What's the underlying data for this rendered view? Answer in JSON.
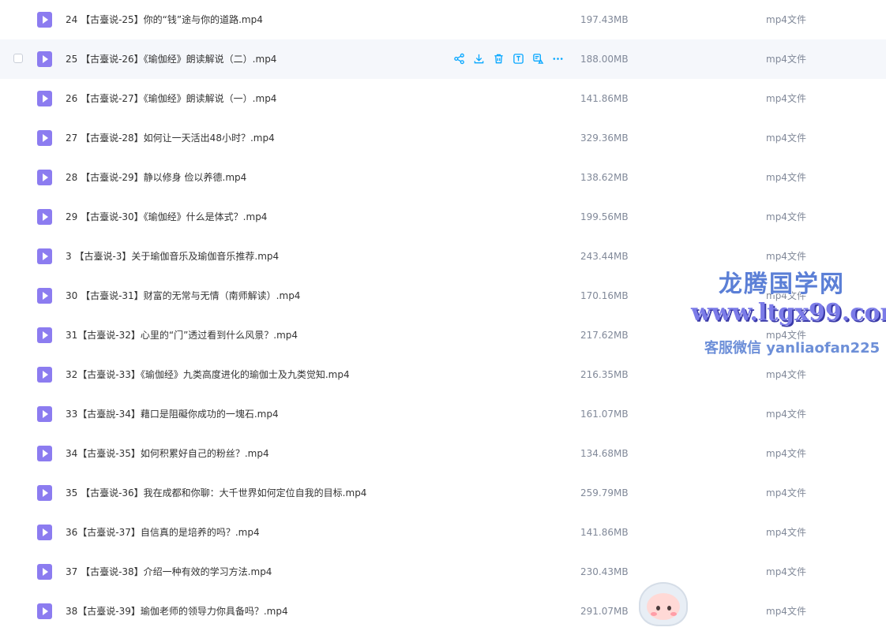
{
  "files": [
    {
      "name": "24 【古臺说-25】你的“钱”途与你的道路.mp4",
      "size": "197.43MB",
      "type": "mp4文件"
    },
    {
      "name": "25 【古臺说-26】《瑜伽经》朗读解说（二）.mp4",
      "size": "188.00MB",
      "type": "mp4文件",
      "hover": true
    },
    {
      "name": "26 【古臺说-27】《瑜伽经》朗读解说（一）.mp4",
      "size": "141.86MB",
      "type": "mp4文件"
    },
    {
      "name": "27 【古臺说-28】如何让一天活出48小时？.mp4",
      "size": "329.36MB",
      "type": "mp4文件"
    },
    {
      "name": "28 【古臺说-29】静以修身 俭以养德.mp4",
      "size": "138.62MB",
      "type": "mp4文件"
    },
    {
      "name": "29 【古臺说-30】《瑜伽经》什么是体式？.mp4",
      "size": "199.56MB",
      "type": "mp4文件"
    },
    {
      "name": "3 【古臺说-3】关于瑜伽音乐及瑜伽音乐推荐.mp4",
      "size": "243.44MB",
      "type": "mp4文件"
    },
    {
      "name": "30 【古臺说-31】财富的无常与无情（南师解读）.mp4",
      "size": "170.16MB",
      "type": "mp4文件"
    },
    {
      "name": "31【古臺说-32】心里的“门”透过看到什么风景？.mp4",
      "size": "217.62MB",
      "type": "mp4文件"
    },
    {
      "name": "32【古臺说-33】《瑜伽经》九类高度进化的瑜伽士及九类觉知.mp4",
      "size": "216.35MB",
      "type": "mp4文件"
    },
    {
      "name": "33【古臺說-34】藉口是阻礙你成功的一塊石.mp4",
      "size": "161.07MB",
      "type": "mp4文件"
    },
    {
      "name": "34【古臺说-35】如何积累好自己的粉丝？.mp4",
      "size": "134.68MB",
      "type": "mp4文件"
    },
    {
      "name": "35 【古臺说-36】我在成都和你聊：大千世界如何定位自我的目标.mp4",
      "size": "259.79MB",
      "type": "mp4文件"
    },
    {
      "name": "36【古臺说-37】自信真的是培养的吗？.mp4",
      "size": "141.86MB",
      "type": "mp4文件"
    },
    {
      "name": "37 【古臺说-38】介绍一种有效的学习方法.mp4",
      "size": "230.43MB",
      "type": "mp4文件"
    },
    {
      "name": "38【古臺说-39】瑜伽老师的领导力你具备吗？.mp4",
      "size": "291.07MB",
      "type": "mp4文件"
    }
  ],
  "row_actions": [
    "share-icon",
    "download-icon",
    "delete-icon",
    "text-icon",
    "image-text-icon",
    "more-icon"
  ],
  "watermark": {
    "line1": "龙腾国学网",
    "line2": "www.ltgx99.com",
    "line3": "客服微信 yanliaofan225"
  },
  "colors": {
    "file_icon": "#8c7cf0",
    "action_icon": "#06a7ff",
    "hover_row": "#f5f7fb",
    "meta_text": "#818999"
  }
}
